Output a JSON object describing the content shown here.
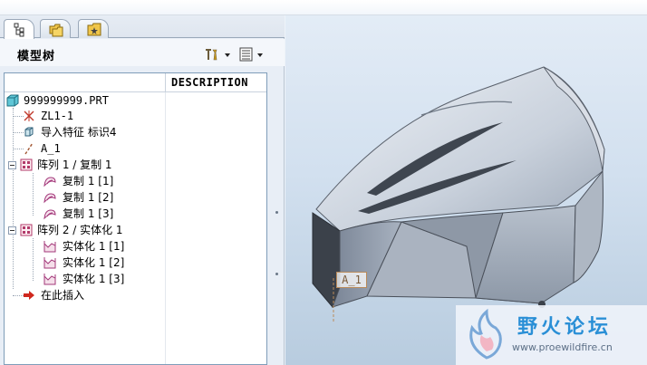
{
  "model_tree": {
    "title": "模型树",
    "column_header": "DESCRIPTION",
    "items": [
      {
        "label": "999999999.PRT",
        "icon": "part-icon"
      },
      {
        "label": "ZL1-1",
        "icon": "coordinate-system-icon"
      },
      {
        "label": "导入特征 标识4",
        "icon": "import-feature-icon"
      },
      {
        "label": "A_1",
        "icon": "datum-axis-icon"
      },
      {
        "label": "阵列 1 / 复制 1",
        "icon": "pattern-icon"
      },
      {
        "label": "复制 1 [1]",
        "icon": "copy-surface-icon"
      },
      {
        "label": "复制 1 [2]",
        "icon": "copy-surface-icon"
      },
      {
        "label": "复制 1 [3]",
        "icon": "copy-surface-icon"
      },
      {
        "label": "阵列 2 / 实体化 1",
        "icon": "pattern-icon"
      },
      {
        "label": "实体化 1 [1]",
        "icon": "solidify-icon"
      },
      {
        "label": "实体化 1 [2]",
        "icon": "solidify-icon"
      },
      {
        "label": "实体化 1 [3]",
        "icon": "solidify-icon"
      },
      {
        "label": "在此插入",
        "icon": "insert-here-arrow-icon"
      }
    ]
  },
  "viewport": {
    "datum_label": "A_1"
  },
  "watermark": {
    "title": "野火论坛",
    "url": "www.proewildfire.cn"
  },
  "colors": {
    "accent": "#2a8fd6",
    "panel": "#e8eef6",
    "model_surface": "#a9b3c1"
  }
}
